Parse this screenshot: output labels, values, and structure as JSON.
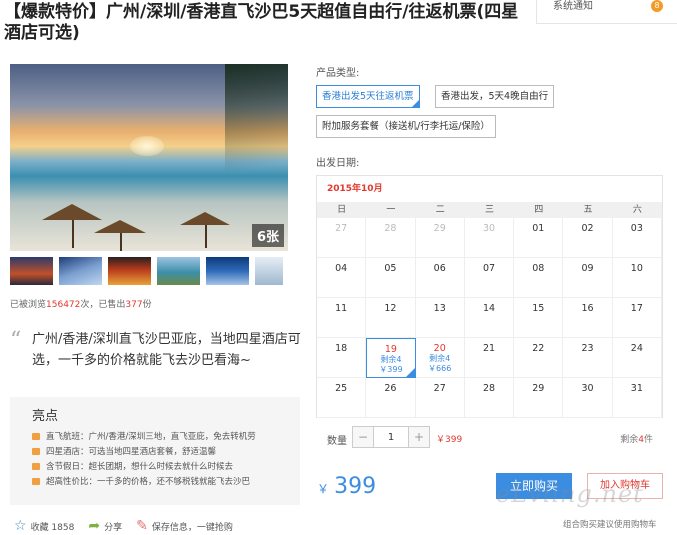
{
  "title": "【爆款特价】广州/深圳/香港直飞沙巴5天超值自由行/往返机票(四星酒店可选)",
  "notification": {
    "label": "系统通知",
    "badge": "8"
  },
  "gallery": {
    "photo_count": "6张",
    "thumbnails": [
      "sunset-sea",
      "coastline",
      "lanterns",
      "boats",
      "blue-ocean",
      "snow"
    ]
  },
  "stats": {
    "prefix": "已被浏览",
    "views": "156472",
    "mid": "次，已售出",
    "sold": "377",
    "suffix": "份"
  },
  "quote": "广州/香港/深圳直飞沙巴亚庇，当地四星酒店可选，一千多的价格就能飞去沙巴看海~",
  "highlights": {
    "title": "亮点",
    "items": [
      "直飞航班：广州/香港/深圳三地，直飞亚庇，免去转机劳",
      "四星酒店：可选当地四星酒店套餐，舒适温馨",
      "含节假日：超长团期，想什么时候去就什么时候去",
      "超高性价比：一千多的价格，还不够税钱就能飞去沙巴"
    ]
  },
  "actions": {
    "favorite": "收藏 1858",
    "share": "分享",
    "save": "保存信息，一键抢购"
  },
  "product_type": {
    "label": "产品类型:",
    "options": [
      "香港出发5天往返机票",
      "香港出发，5天4晚自由行",
      "附加服务套餐（接送机/行李托运/保险）"
    ]
  },
  "departure": {
    "label": "出发日期:",
    "month": "2015年10月",
    "weekdays": [
      "日",
      "一",
      "二",
      "三",
      "四",
      "五",
      "六"
    ],
    "days": [
      {
        "d": "27",
        "prev": true
      },
      {
        "d": "28",
        "prev": true
      },
      {
        "d": "29",
        "prev": true
      },
      {
        "d": "30",
        "prev": true
      },
      {
        "d": "01"
      },
      {
        "d": "02"
      },
      {
        "d": "03"
      },
      {
        "d": "04"
      },
      {
        "d": "05"
      },
      {
        "d": "06"
      },
      {
        "d": "07"
      },
      {
        "d": "08"
      },
      {
        "d": "09"
      },
      {
        "d": "10"
      },
      {
        "d": "11"
      },
      {
        "d": "12"
      },
      {
        "d": "13"
      },
      {
        "d": "14"
      },
      {
        "d": "15"
      },
      {
        "d": "16"
      },
      {
        "d": "17"
      },
      {
        "d": "18"
      },
      {
        "d": "19",
        "remain": "剩余4",
        "price": "￥399",
        "selected": true
      },
      {
        "d": "20",
        "remain": "剩余4",
        "price": "￥666"
      },
      {
        "d": "21"
      },
      {
        "d": "22"
      },
      {
        "d": "23"
      },
      {
        "d": "24"
      },
      {
        "d": "25"
      },
      {
        "d": "26"
      },
      {
        "d": "27"
      },
      {
        "d": "28"
      },
      {
        "d": "29"
      },
      {
        "d": "30"
      },
      {
        "d": "31"
      }
    ]
  },
  "quantity": {
    "label": "数量",
    "value": "1",
    "minus": "−",
    "plus": "+",
    "unit_price": "￥399",
    "remain_prefix": "剩余",
    "remain_count": "4",
    "remain_suffix": "件"
  },
  "price": {
    "currency": "￥",
    "value": "399"
  },
  "buttons": {
    "buy": "立即购买",
    "cart": "加入购物车"
  },
  "hint": "组合购买建议使用购物车",
  "watermark": "eLviing.net",
  "colors": {
    "accent": "#3a8de0",
    "price_red": "#e2382e",
    "highlight_icon": "#f0a040"
  }
}
